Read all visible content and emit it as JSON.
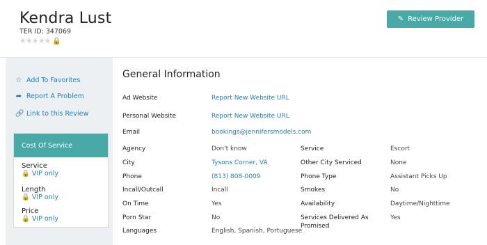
{
  "provider": {
    "name": "Kendra Lust",
    "ter_id": "TER ID: 347069",
    "stars": "★★★★★",
    "lock": "🔒"
  },
  "header": {
    "review_button_label": "Review Provider",
    "review_icon": "✎"
  },
  "sidebar": {
    "links": [
      {
        "icon": "☆",
        "label": "Add To Favorites"
      },
      {
        "icon": "➦",
        "label": "Report A Problem"
      },
      {
        "icon": "🔗",
        "label": "Link to this Review"
      }
    ],
    "cost": {
      "title": "Cost Of Service",
      "items": [
        {
          "label": "Service",
          "value": "VIP only"
        },
        {
          "label": "Length",
          "value": "VIP only"
        },
        {
          "label": "Price",
          "value": "VIP only"
        }
      ],
      "lock_icon": "🔒"
    }
  },
  "general": {
    "title": "General Information",
    "full_rows": [
      {
        "label": "Ad Website",
        "value": "Report New Website URL"
      },
      {
        "label": "Personal Website",
        "value": "Report New Website URL"
      },
      {
        "label": "Email",
        "value": "bookings@jennifersmodels.com"
      }
    ],
    "left": [
      {
        "label": "Agency",
        "value": "Don't know"
      },
      {
        "label": "City",
        "value": "Tysons Corner, VA"
      },
      {
        "label": "Phone",
        "value": "(813) 808-0009"
      },
      {
        "label": "Incall/Outcall",
        "value": "Incall"
      },
      {
        "label": "On Time",
        "value": "Yes"
      },
      {
        "label": "Porn Star",
        "value": "No"
      },
      {
        "label": "Languages",
        "value": "English, Spanish, Portuguese"
      }
    ],
    "right": [
      {
        "label": "Service",
        "value": "Escort"
      },
      {
        "label": "Other City Serviced",
        "value": "None"
      },
      {
        "label": "Phone Type",
        "value": "Assistant Picks Up"
      },
      {
        "label": "Smokes",
        "value": "No"
      },
      {
        "label": "Availability",
        "value": "Daytime/Nighttime"
      },
      {
        "label": "Services Delivered As Promised",
        "value": "Yes"
      }
    ]
  }
}
